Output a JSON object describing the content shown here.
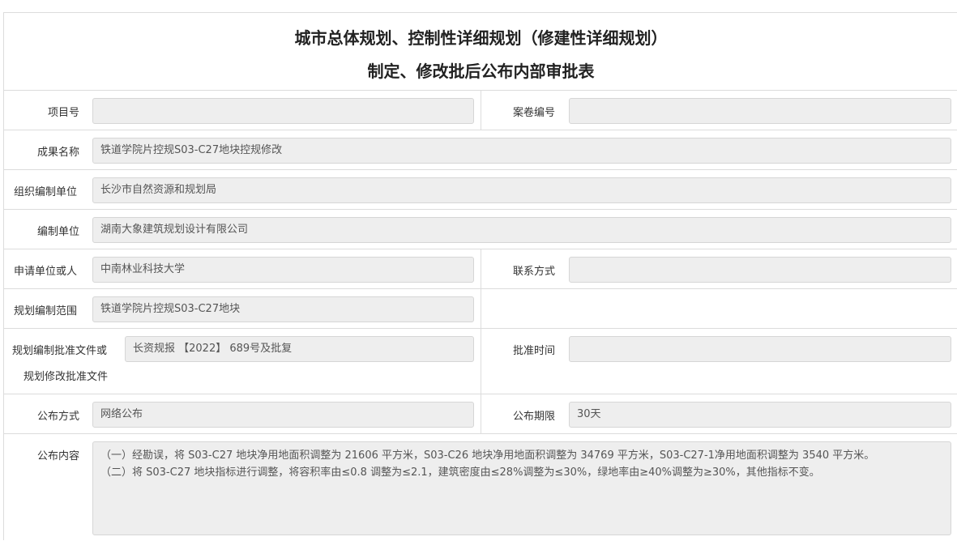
{
  "title": {
    "line1": "城市总体规划、控制性详细规划（修建性详细规划）",
    "line2": "制定、修改批后公布内部审批表"
  },
  "fields": {
    "project_no": {
      "label": "项目号",
      "value": ""
    },
    "archive_no": {
      "label": "案卷编号",
      "value": ""
    },
    "result_name": {
      "label": "成果名称",
      "value": "铁道学院片控规S03-C27地块控规修改"
    },
    "org_unit": {
      "label": "组织编制单位",
      "value": "长沙市自然资源和规划局"
    },
    "compile_unit": {
      "label": "编制单位",
      "value": "湖南大象建筑规划设计有限公司"
    },
    "applicant": {
      "label": "申请单位或人",
      "value": "中南林业科技大学"
    },
    "contact": {
      "label": "联系方式",
      "value": ""
    },
    "scope": {
      "label": "规划编制范围",
      "value": "铁道学院片控规S03-C27地块"
    },
    "approval_doc": {
      "label_line1": "规划编制批准文件或",
      "label_line2": "规划修改批准文件",
      "value": "长资规报 【2022】 689号及批复"
    },
    "approval_time": {
      "label": "批准时间",
      "value": ""
    },
    "publish_method": {
      "label": "公布方式",
      "value": "网络公布"
    },
    "publish_period": {
      "label": "公布期限",
      "value": "30天"
    },
    "publish_content": {
      "label": "公布内容",
      "lines": [
        "（一）经勘误，将 S03-C27 地块净用地面积调整为 21606 平方米，S03-C26 地块净用地面积调整为 34769 平方米，S03-C27-1净用地面积调整为 3540 平方米。",
        "（二）将 S03-C27 地块指标进行调整，将容积率由≤0.8 调整为≤2.1，建筑密度由≤28%调整为≤30%，绿地率由≥40%调整为≥30%，其他指标不变。"
      ]
    }
  }
}
